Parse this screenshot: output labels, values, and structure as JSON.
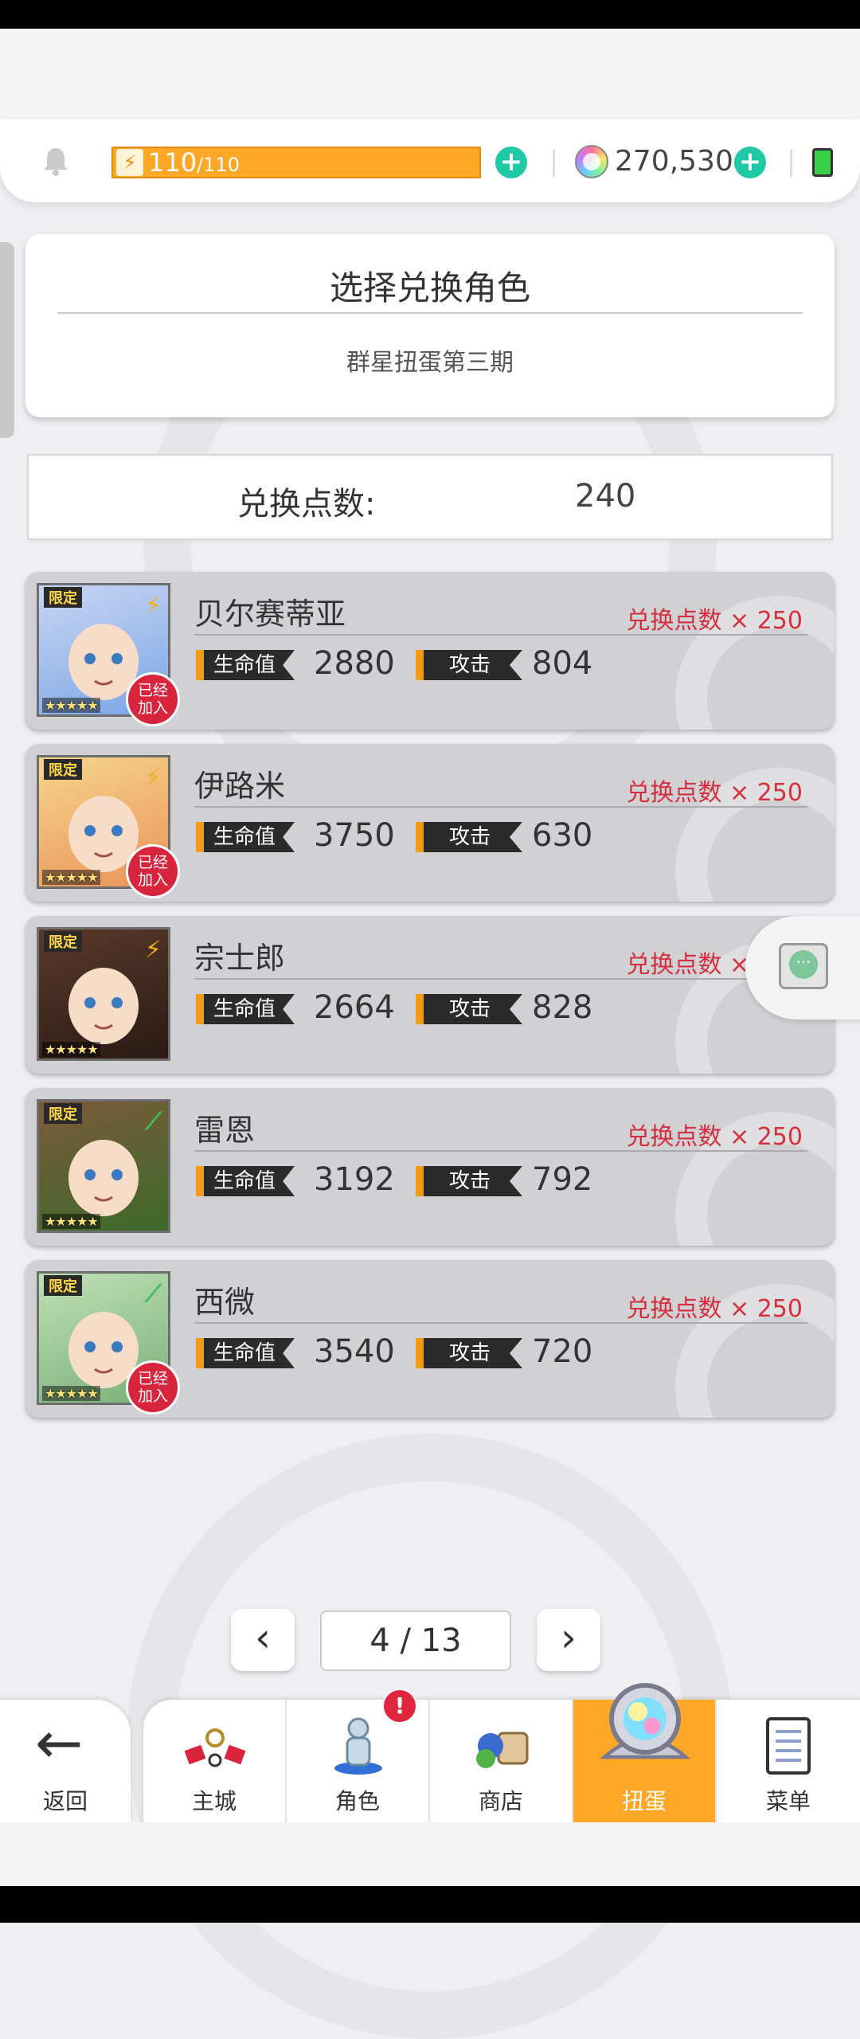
{
  "header": {
    "energy_current": "110",
    "energy_max": "/110",
    "currency_amount": "270,530"
  },
  "title_card": {
    "title": "选择兑换角色",
    "subtitle": "群星扭蛋第三期"
  },
  "points": {
    "label": "兑换点数:",
    "value": "240"
  },
  "characters": [
    {
      "name": "贝尔赛蒂亚",
      "limited": "限定",
      "cost": "兑换点数 × 250",
      "hp_label": "生命值",
      "hp": "2880",
      "atk_label": "攻击",
      "atk": "804",
      "joined": "已经\n加入",
      "element": "lightning",
      "stars": "★★★★★"
    },
    {
      "name": "伊路米",
      "limited": "限定",
      "cost": "兑换点数 × 250",
      "hp_label": "生命值",
      "hp": "3750",
      "atk_label": "攻击",
      "atk": "630",
      "joined": "已经\n加入",
      "element": "lightning",
      "stars": "★★★★★"
    },
    {
      "name": "宗士郎",
      "limited": "限定",
      "cost": "兑换点数 × 250",
      "hp_label": "生命值",
      "hp": "2664",
      "atk_label": "攻击",
      "atk": "828",
      "joined": "",
      "element": "lightning",
      "stars": "★★★★★"
    },
    {
      "name": "雷恩",
      "limited": "限定",
      "cost": "兑换点数 × 250",
      "hp_label": "生命值",
      "hp": "3192",
      "atk_label": "攻击",
      "atk": "792",
      "joined": "",
      "element": "wind",
      "stars": "★★★★★"
    },
    {
      "name": "西微",
      "limited": "限定",
      "cost": "兑换点数 × 250",
      "hp_label": "生命值",
      "hp": "3540",
      "atk_label": "攻击",
      "atk": "720",
      "joined": "已经\n加入",
      "element": "wind",
      "stars": "★★★★★"
    }
  ],
  "pagination": {
    "prev": "‹",
    "next": "›",
    "indicator": "4 / 13"
  },
  "nav": {
    "back_label": "返回",
    "items": [
      {
        "label": "主城",
        "icon": "castle-icon"
      },
      {
        "label": "角色",
        "icon": "character-icon",
        "badge": "!"
      },
      {
        "label": "商店",
        "icon": "shop-icon"
      },
      {
        "label": "扭蛋",
        "icon": "gacha-icon",
        "active": true
      },
      {
        "label": "菜单",
        "icon": "menu-icon"
      }
    ]
  },
  "colors": {
    "accent": "#ffa726",
    "plus": "#1fc9a5",
    "cost_text": "#d32f3f",
    "joined_badge": "#d8243c"
  }
}
